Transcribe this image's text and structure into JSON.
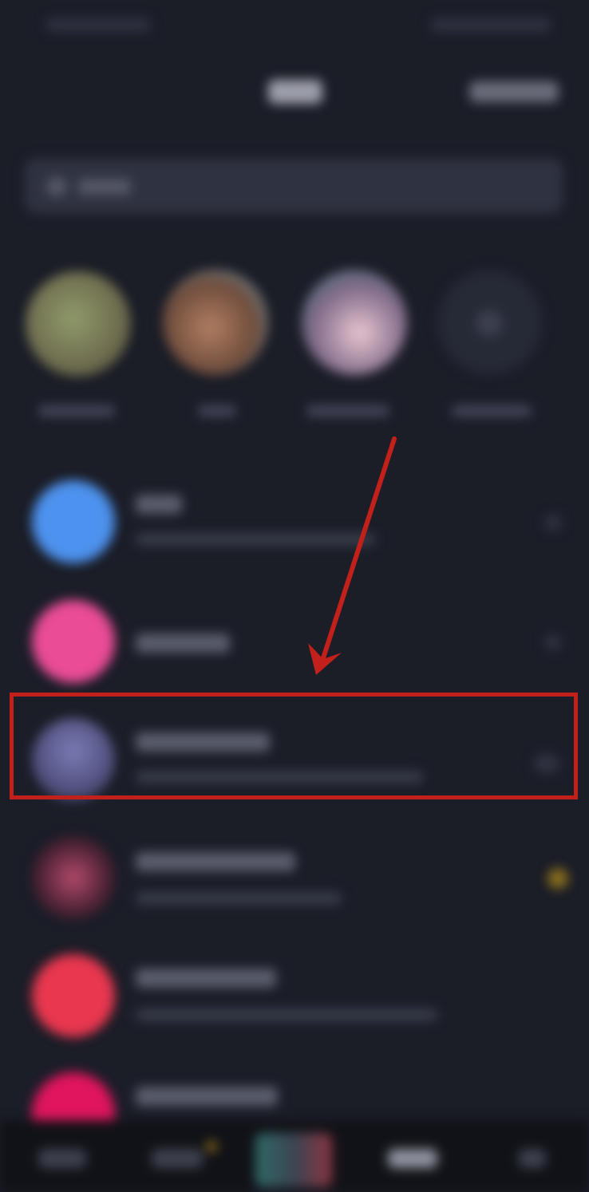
{
  "app": {
    "theme": "dark",
    "content_state": "blurred-unreadable"
  },
  "annotation": {
    "color": "#c1201b",
    "arrow-icon": "arrow-down-left-icon",
    "target": "chat-list-item-3"
  },
  "colors": {
    "background": "#1b1d27",
    "avatar_blue": "#4d92ee",
    "avatar_pink": "#ea4c96",
    "avatar_purple": "#4d4c78",
    "avatar_red": "#e9374f",
    "avatar_magenta": "#e0155e"
  },
  "icons": {
    "search": "search-icon",
    "add_story": "plus-icon"
  }
}
